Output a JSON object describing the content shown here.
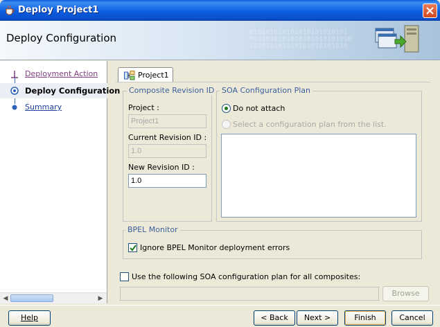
{
  "window": {
    "title": "Deploy Project1",
    "close_icon": "close-icon"
  },
  "header": {
    "title": "Deploy Configuration",
    "binary_art": "010101010101010101010101\n0101010101010101010101010\n101010101010101010101010"
  },
  "nav": {
    "items": [
      {
        "label": "Deployment Action",
        "state": "done"
      },
      {
        "label": "Deploy Configuration",
        "state": "current"
      },
      {
        "label": "Summary",
        "state": "future"
      }
    ]
  },
  "tab": {
    "label": "Project1"
  },
  "revision": {
    "group_label": "Composite Revision ID",
    "project_label": "Project :",
    "project_value": "Project1",
    "current_label": "Current Revision ID :",
    "current_value": "1.0",
    "new_label": "New Revision ID :",
    "new_value": "1.0"
  },
  "soa_plan": {
    "group_label": "SOA Configuration Plan",
    "option_do_not_attach": "Do not attach",
    "option_select_plan": "Select a configuration plan from the list.",
    "selected": "do-not-attach"
  },
  "bpel": {
    "group_label": "BPEL Monitor",
    "ignore_errors_label": "Ignore BPEL Monitor deployment errors",
    "ignore_errors_checked": true
  },
  "use_plan_all": {
    "label": "Use the following SOA configuration plan for all composites:",
    "checked": false,
    "path_value": ""
  },
  "buttons": {
    "browse": "Browse",
    "help": "Help",
    "back": "< Back",
    "next": "Next >",
    "finish": "Finish",
    "cancel": "Cancel"
  },
  "colors": {
    "titlebar": "#0a5fd8",
    "group_label": "#3a5f9c",
    "link_visited": "#7f3f7f",
    "link": "#1c3e9c"
  }
}
